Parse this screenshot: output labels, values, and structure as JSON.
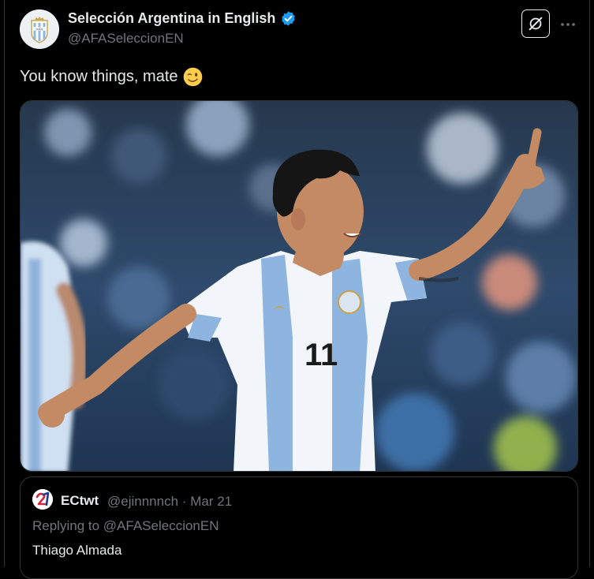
{
  "tweet": {
    "author": {
      "display_name": "Selección Argentina in English",
      "handle": "@AFASeleccionEN",
      "verified": true
    },
    "text": "You know things, mate",
    "emoji": "winking-face",
    "media": {
      "jersey_number": "11"
    },
    "grok_icon": "grok-icon",
    "more_icon": "more-horizontal-icon"
  },
  "quoted_tweet": {
    "display_name": "ECtwt",
    "handle": "@ejinnnnch",
    "separator": "·",
    "date": "Mar 21",
    "replying_to_prefix": "Replying to",
    "replying_to_handle": "@AFASeleccionEN",
    "text": "Thiago Almada"
  },
  "colors": {
    "background": "#000000",
    "text_primary": "#e7e9ea",
    "text_secondary": "#71767b",
    "verified": "#1d9bf0",
    "border": "#2f3336",
    "link": "#1d9bf0"
  }
}
